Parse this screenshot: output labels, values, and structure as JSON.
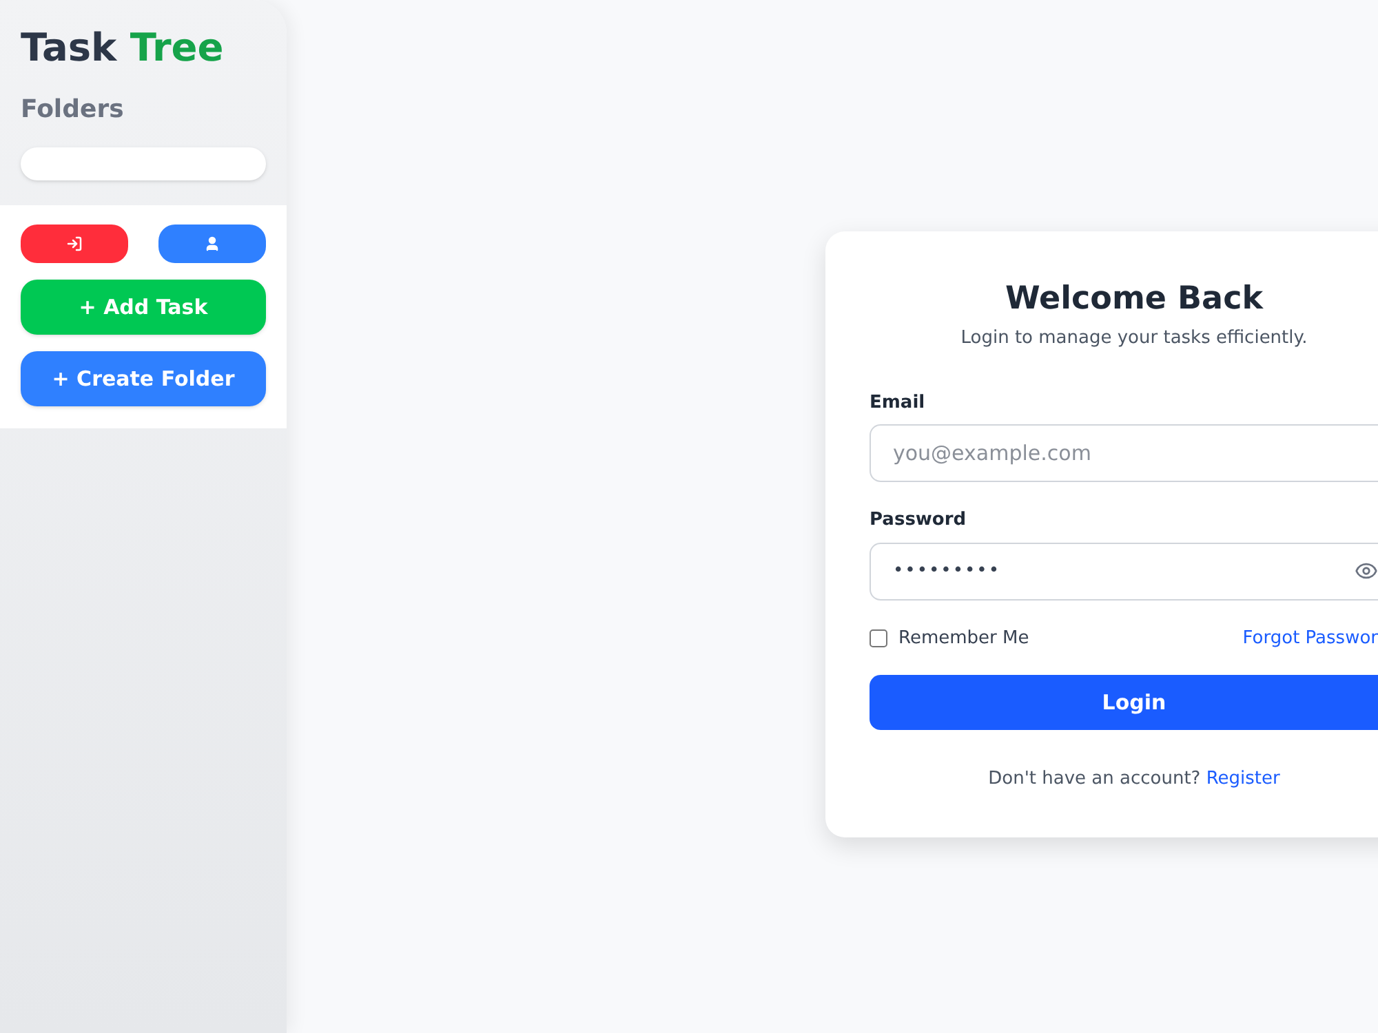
{
  "sidebar": {
    "brand": [
      "Task",
      "Tree"
    ],
    "heading": "Folders",
    "icon_buttons": [
      {
        "kind": "logout"
      },
      {
        "kind": "profile"
      }
    ],
    "actions": [
      {
        "label": "+ Add Task",
        "kind": "green"
      },
      {
        "label": "+ Create Folder",
        "kind": "blue"
      }
    ]
  },
  "login": {
    "title": "Welcome Back",
    "subtitle": "Login to manage your tasks efficiently.",
    "email": {
      "label": "Email",
      "placeholder": "you@example.com"
    },
    "password": {
      "label": "Password",
      "value": "•••••••••"
    },
    "remember": {
      "label": "Remember Me",
      "checked": false
    },
    "forgot": "Forgot Passwor",
    "submit": "Login",
    "footer": {
      "text": "Don't have an account?",
      "link": "Register"
    }
  }
}
